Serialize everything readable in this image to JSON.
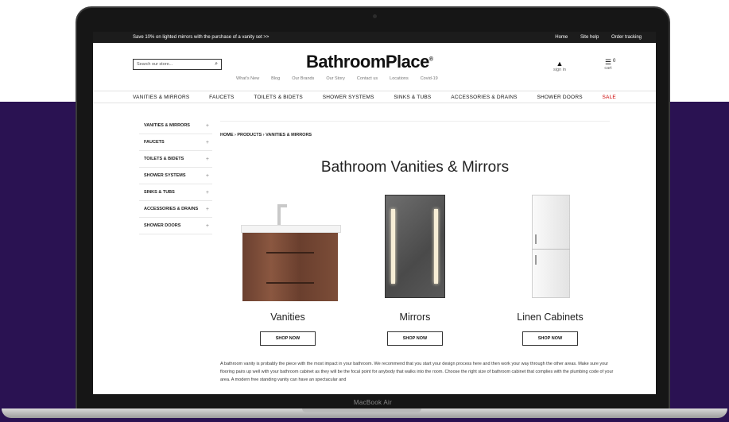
{
  "laptop": {
    "model_label": "MacBook Air"
  },
  "promo": {
    "text": "Save 10% on lighted mirrors with the purchase of a vanity set >>",
    "links": [
      "Home",
      "Site help",
      "Order tracking"
    ]
  },
  "header": {
    "search_placeholder": "Search our store...",
    "logo": "BathroomPlace",
    "logo_mark": "®",
    "account_label": "sign in",
    "cart_label": "cart",
    "cart_count": "0",
    "secondary_nav": [
      "What's New",
      "Blog",
      "Our Brands",
      "Our Story",
      "Contact us",
      "Locations",
      "Covid-19"
    ]
  },
  "main_nav": {
    "items": [
      "VANITIES & MIRRORS",
      "FAUCETS",
      "TOILETS & BIDETS",
      "SHOWER SYSTEMS",
      "SINKS & TUBS",
      "ACCESSORIES & DRAINS",
      "SHOWER DOORS"
    ],
    "sale": "SALE",
    "sale_color": "#cc0000"
  },
  "sidebar": {
    "items": [
      "VANITIES & MIRRORS",
      "FAUCETS",
      "TOILETS & BIDETS",
      "SHOWER SYSTEMS",
      "SINKS & TUBS",
      "ACCESSORIES & DRAINS",
      "SHOWER DOORS"
    ],
    "expand_glyph": "+"
  },
  "main": {
    "breadcrumb": "HOME › PRODUCTS › VANITIES & MIRRORS",
    "title": "Bathroom Vanities & Mirrors",
    "products": [
      {
        "name": "Vanities",
        "button": "SHOP NOW"
      },
      {
        "name": "Mirrors",
        "button": "SHOP NOW"
      },
      {
        "name": "Linen Cabinets",
        "button": "SHOP NOW"
      }
    ],
    "description": "A bathroom vanity is probably the piece with the most impact in your bathroom. We recommend that you start your design process here and then work your way through the other areas. Make sure your flooring pairs up well with your bathroom cabinet as they will be the focal point for anybody that walks into the room. Choose the right size of bathroom cabinet that complies with the plumbing code of your area. A modern free standing vanity can have an spectacular and"
  },
  "colors": {
    "background_accent": "#2a1252",
    "promo_bar": "#1c1c1c"
  }
}
